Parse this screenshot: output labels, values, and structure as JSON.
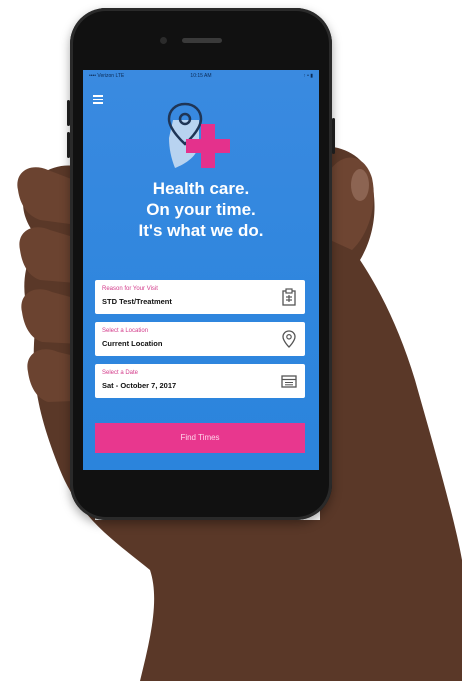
{
  "status_bar": {
    "carrier": "•••• Verizon LTE",
    "time": "10:15 AM",
    "battery": "↑ • ▮"
  },
  "header": {
    "menu_icon": "hamburger-menu-icon",
    "logo_icon": "location-pin-plus-icon"
  },
  "hero": {
    "line1": "Health care.",
    "line2": "On your time.",
    "line3": "It's what we do."
  },
  "form": {
    "reason": {
      "label": "Reason for Your Visit",
      "value": "STD Test/Treatment",
      "icon": "clipboard-icon"
    },
    "location": {
      "label": "Select a Location",
      "value": "Current Location",
      "icon": "location-pin-icon"
    },
    "date": {
      "label": "Select a Date",
      "value": "Sat - October 7, 2017",
      "icon": "calendar-icon"
    }
  },
  "actions": {
    "find_times_label": "Find Times"
  },
  "colors": {
    "screen_blue": "#2f86de",
    "accent_pink": "#e8378e",
    "label_pink": "#d33a8a"
  }
}
